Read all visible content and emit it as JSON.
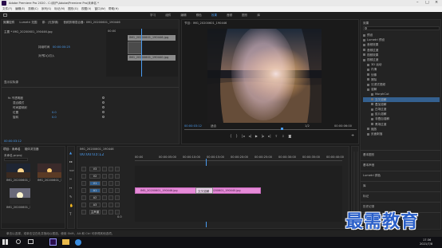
{
  "app": {
    "title": "Adobe Premiere Pro 2020 - C:\\用户\\Adobe\\Premiere Pro\\未命名 *",
    "menu": [
      "文件(F)",
      "编辑(E)",
      "剪辑(C)",
      "序列(S)",
      "标记(M)",
      "图形(G)",
      "视图(V)",
      "窗口(W)",
      "帮助(H)"
    ]
  },
  "workspaces": [
    "学习",
    "组件",
    "编辑",
    "颜色",
    "效果",
    "音频",
    "图形",
    "库"
  ],
  "effect_controls": {
    "tabs": [
      "效果控件",
      "Lumetri 范围",
      "源：(无剪辑)",
      "音频剪辑混合器：IMG_20200601_190446"
    ],
    "source_label": "主要 * IMG_20200601_190446.jpg",
    "seq_label": "IMG_20200601_190446 * IMG_20200601_190446.jpg",
    "timecode_start": "00:00",
    "clip1": "IMG_20200601_190446.jpg",
    "clip2": "IMG_20200601_190440.jpg",
    "transition": {
      "name": "持续时间",
      "value": "00:00:00:25",
      "align_label": "对齐",
      "align_value": "中心切入"
    },
    "section": "显示实际源",
    "motion_items": [
      {
        "name": "fx 不透明度"
      },
      {
        "name": "混合模式"
      },
      {
        "name": "时间重映射"
      },
      {
        "name": "位置",
        "value": "0.0"
      },
      {
        "name": "旋转",
        "value": "0.0"
      }
    ],
    "bottom_timecode": "00:00:03:12"
  },
  "program_monitor": {
    "title": "节目：IMG_20200601_190446",
    "timecode_left": "00:00:03:12",
    "fit": "适合",
    "quality": "1/2",
    "timecode_right": "00:00:06:00"
  },
  "effects_panel": {
    "title": "效果",
    "items": [
      {
        "label": "预设",
        "depth": 0,
        "selected": false
      },
      {
        "label": "Lumetri 预设",
        "depth": 0,
        "selected": false
      },
      {
        "label": "音频效果",
        "depth": 0,
        "selected": false
      },
      {
        "label": "音频过渡",
        "depth": 0,
        "selected": false
      },
      {
        "label": "视频效果",
        "depth": 0,
        "selected": false
      },
      {
        "label": "视频过渡",
        "depth": 0,
        "selected": false
      },
      {
        "label": "3D 运动",
        "depth": 1,
        "selected": false
      },
      {
        "label": "内滑",
        "depth": 1,
        "selected": false
      },
      {
        "label": "划像",
        "depth": 1,
        "selected": false
      },
      {
        "label": "擦除",
        "depth": 1,
        "selected": false
      },
      {
        "label": "沉浸式视频",
        "depth": 1,
        "selected": false
      },
      {
        "label": "溶解",
        "depth": 1,
        "selected": false
      },
      {
        "label": "MorphCut",
        "depth": 2,
        "selected": false
      },
      {
        "label": "交叉溶解",
        "depth": 2,
        "selected": true
      },
      {
        "label": "叠加溶解",
        "depth": 2,
        "selected": false
      },
      {
        "label": "白场过渡",
        "depth": 2,
        "selected": false
      },
      {
        "label": "胶片溶解",
        "depth": 2,
        "selected": false
      },
      {
        "label": "非叠加溶解",
        "depth": 2,
        "selected": false
      },
      {
        "label": "黑场过渡",
        "depth": 2,
        "selected": false
      },
      {
        "label": "缩放",
        "depth": 1,
        "selected": false
      },
      {
        "label": "页面剥落",
        "depth": 1,
        "selected": false
      }
    ],
    "sections": [
      "基本图形",
      "基本声音",
      "Lumetri 颜色",
      "库",
      "标记",
      "历史记录",
      "信息"
    ]
  },
  "project": {
    "tabs": [
      "项目：未命名",
      "媒体浏览器"
    ],
    "name": "未命名.prproj",
    "items": [
      {
        "name": "IMG_20200601_19...",
        "dur": "5:00"
      },
      {
        "name": "IMG_20200601_19...",
        "dur": "5:00"
      },
      {
        "name": "IMG_20200601_19...",
        "dur": "5:00"
      }
    ]
  },
  "timeline": {
    "tab": "IMG_20200601_190446",
    "timecode": "00:00:03:12",
    "ruler": [
      "00:00",
      "00:00:05:00",
      "00:00:10:00",
      "00:00:15:00",
      "00:00:20:00",
      "00:00:25:00",
      "00:00:30:00",
      "00:00:35:00",
      "00:00:40:00"
    ],
    "tracks": [
      "V3",
      "V2",
      "V1",
      "A1",
      "A2",
      "A3",
      "主声道"
    ],
    "master_value": "0.0",
    "clips": [
      {
        "name": "IMG_20200601_190446.jpg"
      },
      {
        "name": "IMG_20200601_190440.jpg"
      }
    ],
    "transition_label": "交叉溶解"
  },
  "status": "单击以选择，或单击空白处并拖动以框选。使用 Shift、Alt 和 Ctrl 可获得其他选项。",
  "taskbar": {
    "time": "17:36",
    "date": "2021/7/8"
  },
  "watermark": "最需教育",
  "colors": {
    "accent": "#4a9cf0",
    "clip": "#e68ad8",
    "workspace_active": "#4a9cf0"
  }
}
